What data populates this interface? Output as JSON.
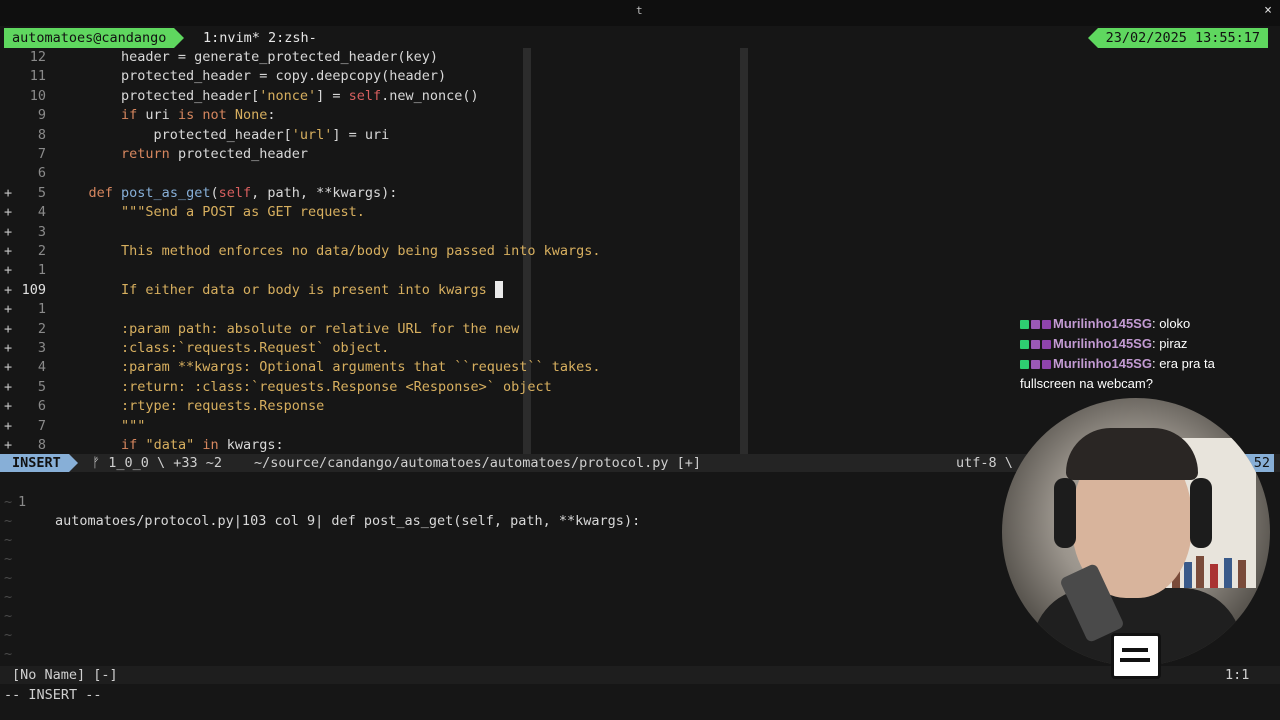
{
  "window": {
    "title": "t",
    "close_glyph": "×"
  },
  "tmux": {
    "session": "automatoes@candango",
    "windows": "1:nvim* 2:zsh-",
    "clock": "23/02/2025 13:55:17"
  },
  "editor": {
    "lines": [
      {
        "sign": "",
        "num": "12",
        "code": [
          {
            "t": "        header = generate_protected_header(key)"
          }
        ]
      },
      {
        "sign": "",
        "num": "11",
        "code": [
          {
            "t": "        protected_header = copy.deepcopy(header)"
          }
        ]
      },
      {
        "sign": "",
        "num": "10",
        "code": [
          {
            "t": "        protected_header[",
            "c": ""
          },
          {
            "t": "'nonce'",
            "c": "str"
          },
          {
            "t": "] = "
          },
          {
            "t": "self",
            "c": "self"
          },
          {
            "t": ".new_nonce()"
          }
        ]
      },
      {
        "sign": "",
        "num": "9",
        "code": [
          {
            "t": "        "
          },
          {
            "t": "if",
            "c": "kw"
          },
          {
            "t": " uri "
          },
          {
            "t": "is not",
            "c": "kw"
          },
          {
            "t": " "
          },
          {
            "t": "None",
            "c": "str"
          },
          {
            "t": ":"
          }
        ]
      },
      {
        "sign": "",
        "num": "8",
        "code": [
          {
            "t": "            protected_header["
          },
          {
            "t": "'url'",
            "c": "str"
          },
          {
            "t": "] = uri"
          }
        ]
      },
      {
        "sign": "",
        "num": "7",
        "code": [
          {
            "t": "        "
          },
          {
            "t": "return",
            "c": "kw"
          },
          {
            "t": " protected_header"
          }
        ]
      },
      {
        "sign": "",
        "num": "6",
        "code": [
          {
            "t": ""
          }
        ]
      },
      {
        "sign": "+",
        "num": "5",
        "code": [
          {
            "t": "    "
          },
          {
            "t": "def",
            "c": "kw"
          },
          {
            "t": " "
          },
          {
            "t": "post_as_get",
            "c": "fn"
          },
          {
            "t": "("
          },
          {
            "t": "self",
            "c": "self"
          },
          {
            "t": ", path, **kwargs):"
          }
        ]
      },
      {
        "sign": "+",
        "num": "4",
        "code": [
          {
            "t": "        \"\"\"Send a POST as GET request.",
            "c": "str"
          }
        ]
      },
      {
        "sign": "+",
        "num": "3",
        "code": [
          {
            "t": ""
          }
        ]
      },
      {
        "sign": "+",
        "num": "2",
        "code": [
          {
            "t": "        This method enforces no data/body being passed into kwargs.",
            "c": "str"
          }
        ]
      },
      {
        "sign": "+",
        "num": "1",
        "code": [
          {
            "t": ""
          }
        ]
      },
      {
        "sign": "+",
        "num": "109",
        "current": true,
        "code": [
          {
            "t": "        If either data or body is present into kwargs ",
            "c": "str"
          }
        ],
        "cursor": true
      },
      {
        "sign": "+",
        "num": "1",
        "code": [
          {
            "t": ""
          }
        ]
      },
      {
        "sign": "+",
        "num": "2",
        "code": [
          {
            "t": "        :param path: absolute or relative URL for the new",
            "c": "str"
          }
        ]
      },
      {
        "sign": "+",
        "num": "3",
        "code": [
          {
            "t": "        :class:`requests.Request` object.",
            "c": "str"
          }
        ]
      },
      {
        "sign": "+",
        "num": "4",
        "code": [
          {
            "t": "        :param **kwargs: Optional arguments that ``request`` takes.",
            "c": "str"
          }
        ]
      },
      {
        "sign": "+",
        "num": "5",
        "code": [
          {
            "t": "        :return: :class:`requests.Response <Response>` object",
            "c": "str"
          }
        ]
      },
      {
        "sign": "+",
        "num": "6",
        "code": [
          {
            "t": "        :rtype: requests.Response",
            "c": "str"
          }
        ]
      },
      {
        "sign": "+",
        "num": "7",
        "code": [
          {
            "t": "        \"\"\"",
            "c": "str"
          }
        ]
      },
      {
        "sign": "+",
        "num": "8",
        "code": [
          {
            "t": "        "
          },
          {
            "t": "if",
            "c": "kw"
          },
          {
            "t": " "
          },
          {
            "t": "\"data\"",
            "c": "str"
          },
          {
            "t": " "
          },
          {
            "t": "in",
            "c": "kw"
          },
          {
            "t": " kwargs:"
          }
        ]
      }
    ]
  },
  "statusline": {
    "mode": "INSERT",
    "branch": "ᚠ 1_0_0 \\ +33 ~2",
    "path": "~/source/candango/automatoes/automatoes/protocol.py [+]",
    "encoding": "utf-8 \\",
    "position": "52"
  },
  "quickfix": {
    "num": "1",
    "text": "automatoes/protocol.py|103 col 9| def post_as_get(self, path, **kwargs):"
  },
  "bottombar": {
    "name": "[No Name] [-]",
    "pos": "1:1"
  },
  "cmdline": "-- INSERT --",
  "chat": [
    {
      "user": "Murilinho145SG",
      "text": "oloko"
    },
    {
      "user": "Murilinho145SG",
      "text": "piraz"
    },
    {
      "user": "Murilinho145SG",
      "text": "era pra ta fullscreen na webcam?"
    }
  ],
  "colors": {
    "accent_green": "#5fd75f",
    "accent_blue": "#87afd7"
  }
}
